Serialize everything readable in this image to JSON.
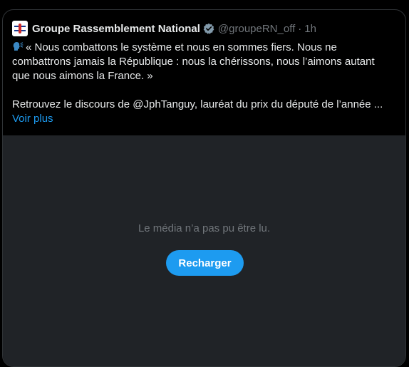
{
  "tweet": {
    "author_name": "Groupe Rassemblement National",
    "handle": "@groupeRN_off",
    "separator": "·",
    "time": "1h",
    "text_line1": "« Nous combattons le système et nous en sommes fiers. Nous ne combattrons jamais la République : nous la chérissons, nous l’aimons autant que nous aimons la France. »",
    "text_line2": "Retrouvez le discours de @JphTanguy, lauréat du prix du député de l’année ...",
    "more_label": "Voir plus",
    "leading_icon": "speaking-head-icon",
    "verified_icon": "verified-badge-icon"
  },
  "media": {
    "error_message": "Le média n’a pas pu être lu.",
    "reload_label": "Recharger"
  },
  "colors": {
    "background": "#000000",
    "media_background": "#202327",
    "text_primary": "#e7e9ea",
    "text_secondary": "#71767b",
    "accent": "#1d9bf0",
    "border": "#2f3336"
  }
}
